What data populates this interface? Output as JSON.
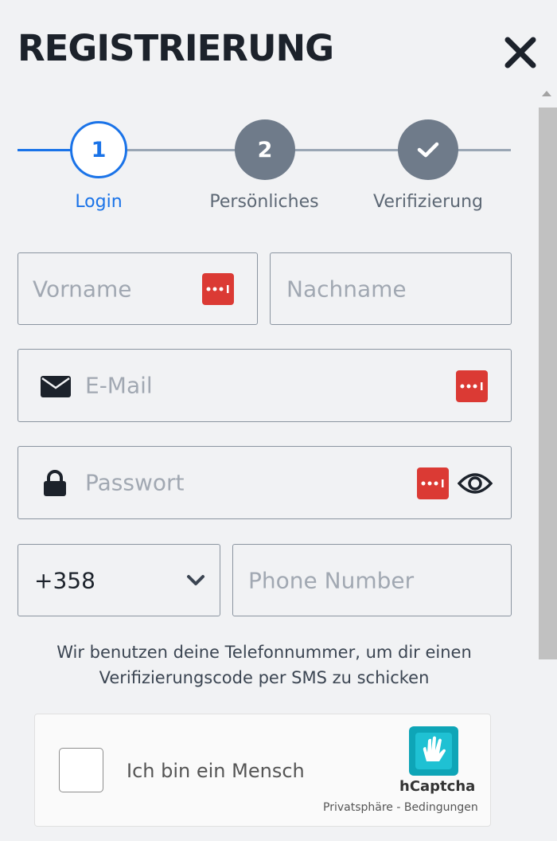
{
  "header": {
    "title": "REGISTRIERUNG"
  },
  "stepper": {
    "steps": [
      {
        "number": "1",
        "label": "Login",
        "state": "active"
      },
      {
        "number": "2",
        "label": "Persönliches",
        "state": "inactive"
      },
      {
        "number": "",
        "label": "Verifizierung",
        "state": "inactive"
      }
    ]
  },
  "form": {
    "first_name_placeholder": "Vorname",
    "last_name_placeholder": "Nachname",
    "email_placeholder": "E-Mail",
    "password_placeholder": "Passwort",
    "country_code_value": "+358",
    "phone_placeholder": "Phone Number",
    "helper_text": "Wir benutzen deine Telefonnummer, um dir einen Verifizierungscode per SMS zu schicken"
  },
  "captcha": {
    "label": "Ich bin ein Mensch",
    "brand": "hCaptcha",
    "links": "Privatsphäre - Bedingungen"
  },
  "colors": {
    "accent": "#1a73e8",
    "inactive_step": "#6f7b8a",
    "password_manager": "#db3a34"
  }
}
